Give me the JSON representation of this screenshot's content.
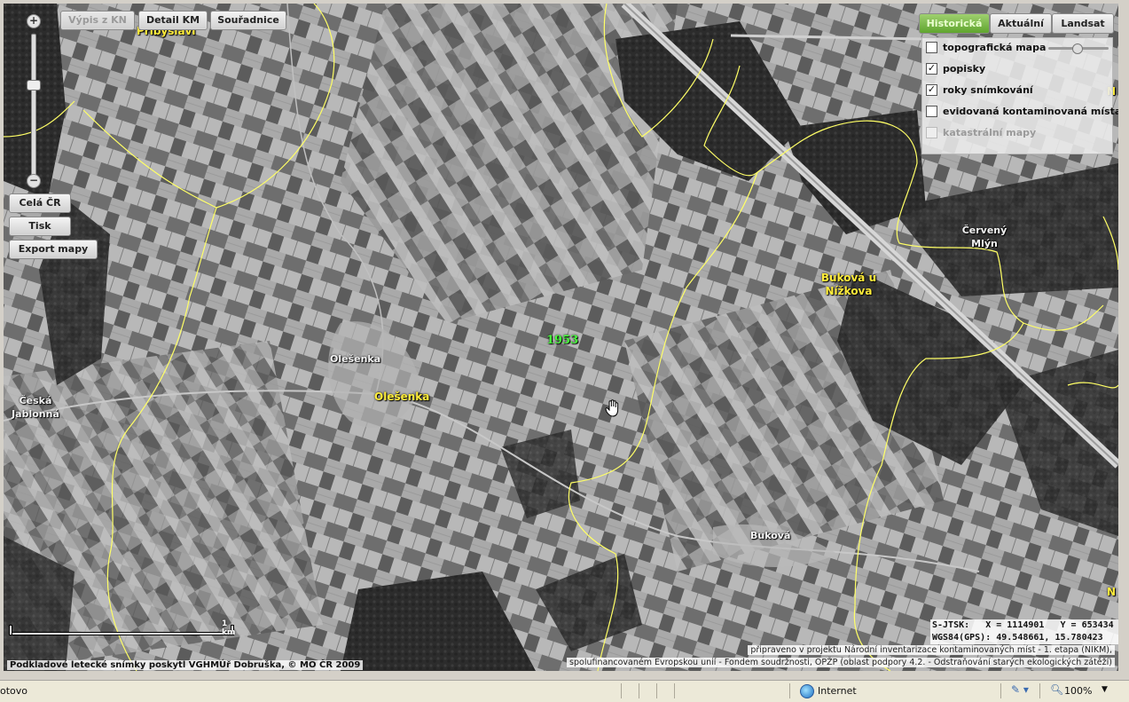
{
  "toolbar": {
    "buttons": [
      "Výpis z KN",
      "Detail KM",
      "Souřadnice"
    ],
    "side_buttons": [
      "Celá ČR",
      "Tisk",
      "Export mapy"
    ]
  },
  "zoom": {
    "plus": "+",
    "minus": "−",
    "level": 0.45
  },
  "map_tabs": [
    "Historická",
    "Aktuální",
    "Landsat"
  ],
  "layers": [
    {
      "label": "topografická mapa",
      "checked": false,
      "enabled": true
    },
    {
      "label": "popisky",
      "checked": true,
      "enabled": true
    },
    {
      "label": "roky snímkování",
      "checked": true,
      "enabled": true
    },
    {
      "label": "evidovaná kontaminovaná místa",
      "checked": false,
      "enabled": true
    },
    {
      "label": "katastrální mapy",
      "checked": false,
      "enabled": false
    }
  ],
  "places": {
    "pribyslavi": "Přibyslavi",
    "cervena_mlyn": "Červený Mlýn",
    "bukova_u_nizkova": "Buková u Nížkova",
    "olesenka_village": "Olešenka",
    "olesenka": "Olešenka",
    "ceska_jablonna": "Česká Jablonná",
    "bukova": "Buková",
    "n_top": "N",
    "n_bottom": "N"
  },
  "year_label": "1953",
  "scale": {
    "label": "1 km"
  },
  "coords": {
    "line1": "S-JTSK:   X = 1114901   Y = 653434",
    "line2": "WGS84(GPS): 49.548661, 15.780423"
  },
  "credit": "Podkladové letecké snímky poskytl VGHMÚř Dobruška, © MO ČR 2009",
  "project_info": {
    "line1": "připraveno v projektu Národní inventarizace kontaminovaných míst - 1. etapa (NIKM),",
    "line2": "spolufinancovaném Evropskou unií - Fondem soudržnosti, OPŽP (oblast podpory 4.2. - Odstraňování starých ekologických zátěží)"
  },
  "statusbar": {
    "left": "otovo",
    "zone": "Internet",
    "zoom": "100%"
  }
}
